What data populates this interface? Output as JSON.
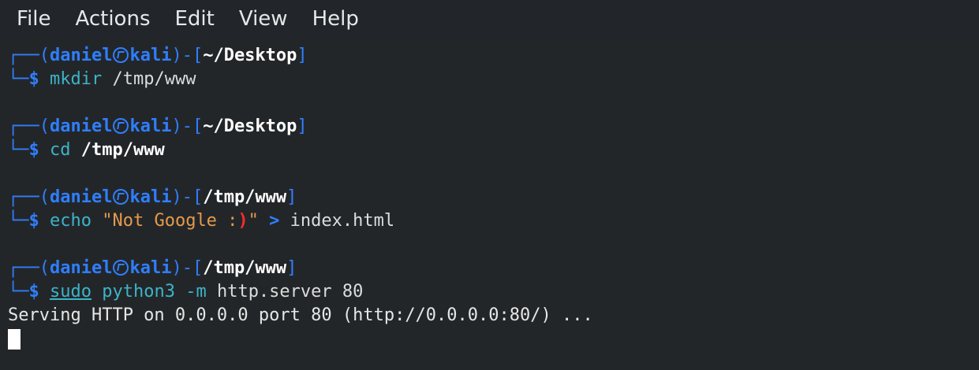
{
  "menu": {
    "file": "File",
    "actions": "Actions",
    "edit": "Edit",
    "view": "View",
    "help": "Help"
  },
  "terminal": {
    "prompt_user": "daniel",
    "prompt_host": "kali",
    "blocks": [
      {
        "cwd": "~/Desktop",
        "cmd": "mkdir",
        "arg": "/tmp/www"
      },
      {
        "cwd": "~/Desktop",
        "cmd": "cd",
        "arg": "/tmp/www"
      },
      {
        "cwd": "/tmp/www",
        "cmd": "echo",
        "string_part1": "\"Not Google :",
        "string_red": ")",
        "string_part2": "\"",
        "redirect": ">",
        "file": "index.html"
      },
      {
        "cwd": "/tmp/www",
        "sudo": "sudo",
        "cmd": "python3",
        "flag": "-m",
        "module": "http.server",
        "port": "80"
      }
    ],
    "output": "Serving HTTP on 0.0.0.0 port 80 (http://0.0.0.0:80/) ..."
  },
  "colors": {
    "background": "#232629",
    "prompt_blue": "#2f7fff",
    "command_teal": "#3cb4c8",
    "string_orange": "#e59a4c",
    "red": "#ff2b2b"
  }
}
